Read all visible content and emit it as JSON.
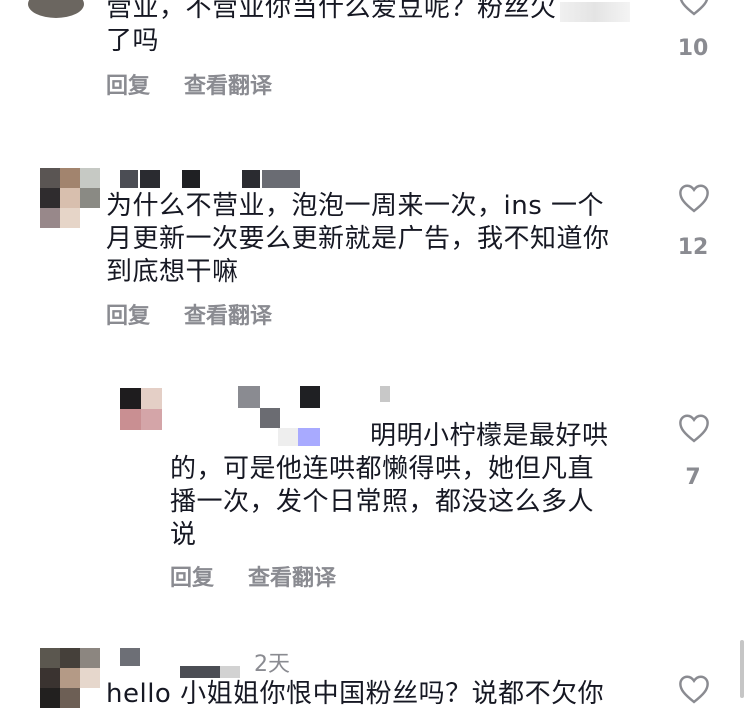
{
  "comments": [
    {
      "text_line1": "营业，不营业你当什么爱豆呢？粉丝欠",
      "text_line2": "了吗",
      "reply_label": "回复",
      "translate_label": "查看翻译",
      "likes": "10"
    },
    {
      "text_line1": "为什么不营业，泡泡一周来一次，ins 一个",
      "text_line2": "月更新一次要么更新就是广告，我不知道你",
      "text_line3": "到底想干嘛",
      "reply_label": "回复",
      "translate_label": "查看翻译",
      "likes": "12"
    },
    {
      "text_line1": "明明小柠檬是最好哄",
      "text_line2": "的，可是他连哄都懒得哄，她但凡直",
      "text_line3": "播一次，发个日常照，都没这么多人",
      "text_line4": "说",
      "reply_label": "回复",
      "translate_label": "查看翻译",
      "likes": "7"
    },
    {
      "time": "2天",
      "text_line1": "hello 小姐姐你恨中国粉丝吗？说都不欠你"
    }
  ],
  "icons": {
    "like": "heart-outline-icon"
  },
  "colors": {
    "text": "#161823",
    "secondary": "#8a8b91"
  }
}
